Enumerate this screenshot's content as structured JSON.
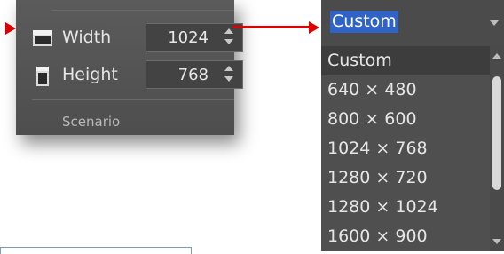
{
  "panel": {
    "width_label": "Width",
    "width_value": "1024",
    "height_label": "Height",
    "height_value": "768",
    "section_label": "Scenario"
  },
  "dropdown": {
    "selected": "Custom",
    "options": [
      "Custom",
      "640 × 480",
      "800 × 600",
      "1024 × 768",
      "1280 × 720",
      "1280 × 1024",
      "1600 × 900"
    ]
  },
  "colors": {
    "arrow": "#e00000",
    "selection": "#2f63c8",
    "panel_bg": "#555555"
  },
  "icons": [
    "width-icon",
    "height-icon",
    "chevron-up-icon",
    "chevron-down-icon",
    "dropdown-caret-icon"
  ]
}
